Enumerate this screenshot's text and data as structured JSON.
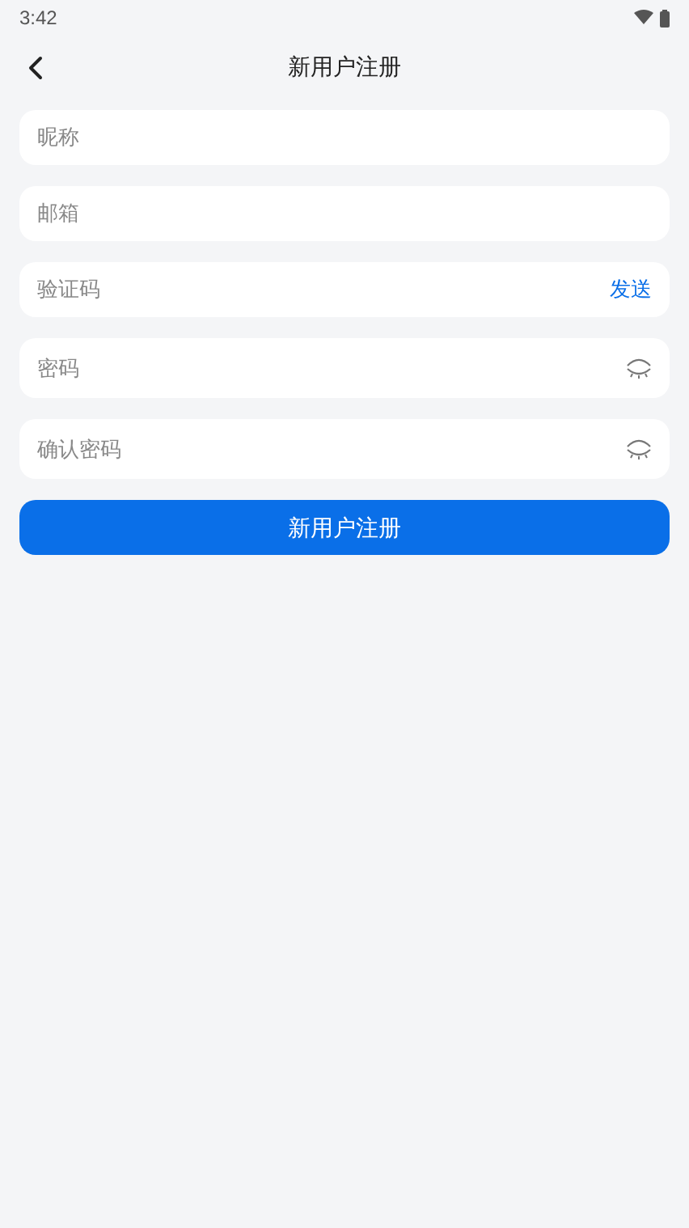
{
  "status_bar": {
    "time": "3:42"
  },
  "header": {
    "title": "新用户注册"
  },
  "fields": [
    {
      "kind": "text",
      "placeholder": "昵称"
    },
    {
      "kind": "text",
      "placeholder": "邮箱"
    },
    {
      "kind": "code",
      "placeholder": "验证码",
      "action": "发送"
    },
    {
      "kind": "password",
      "placeholder": "密码"
    },
    {
      "kind": "password",
      "placeholder": "确认密码"
    }
  ],
  "submit": {
    "label": "新用户注册"
  }
}
